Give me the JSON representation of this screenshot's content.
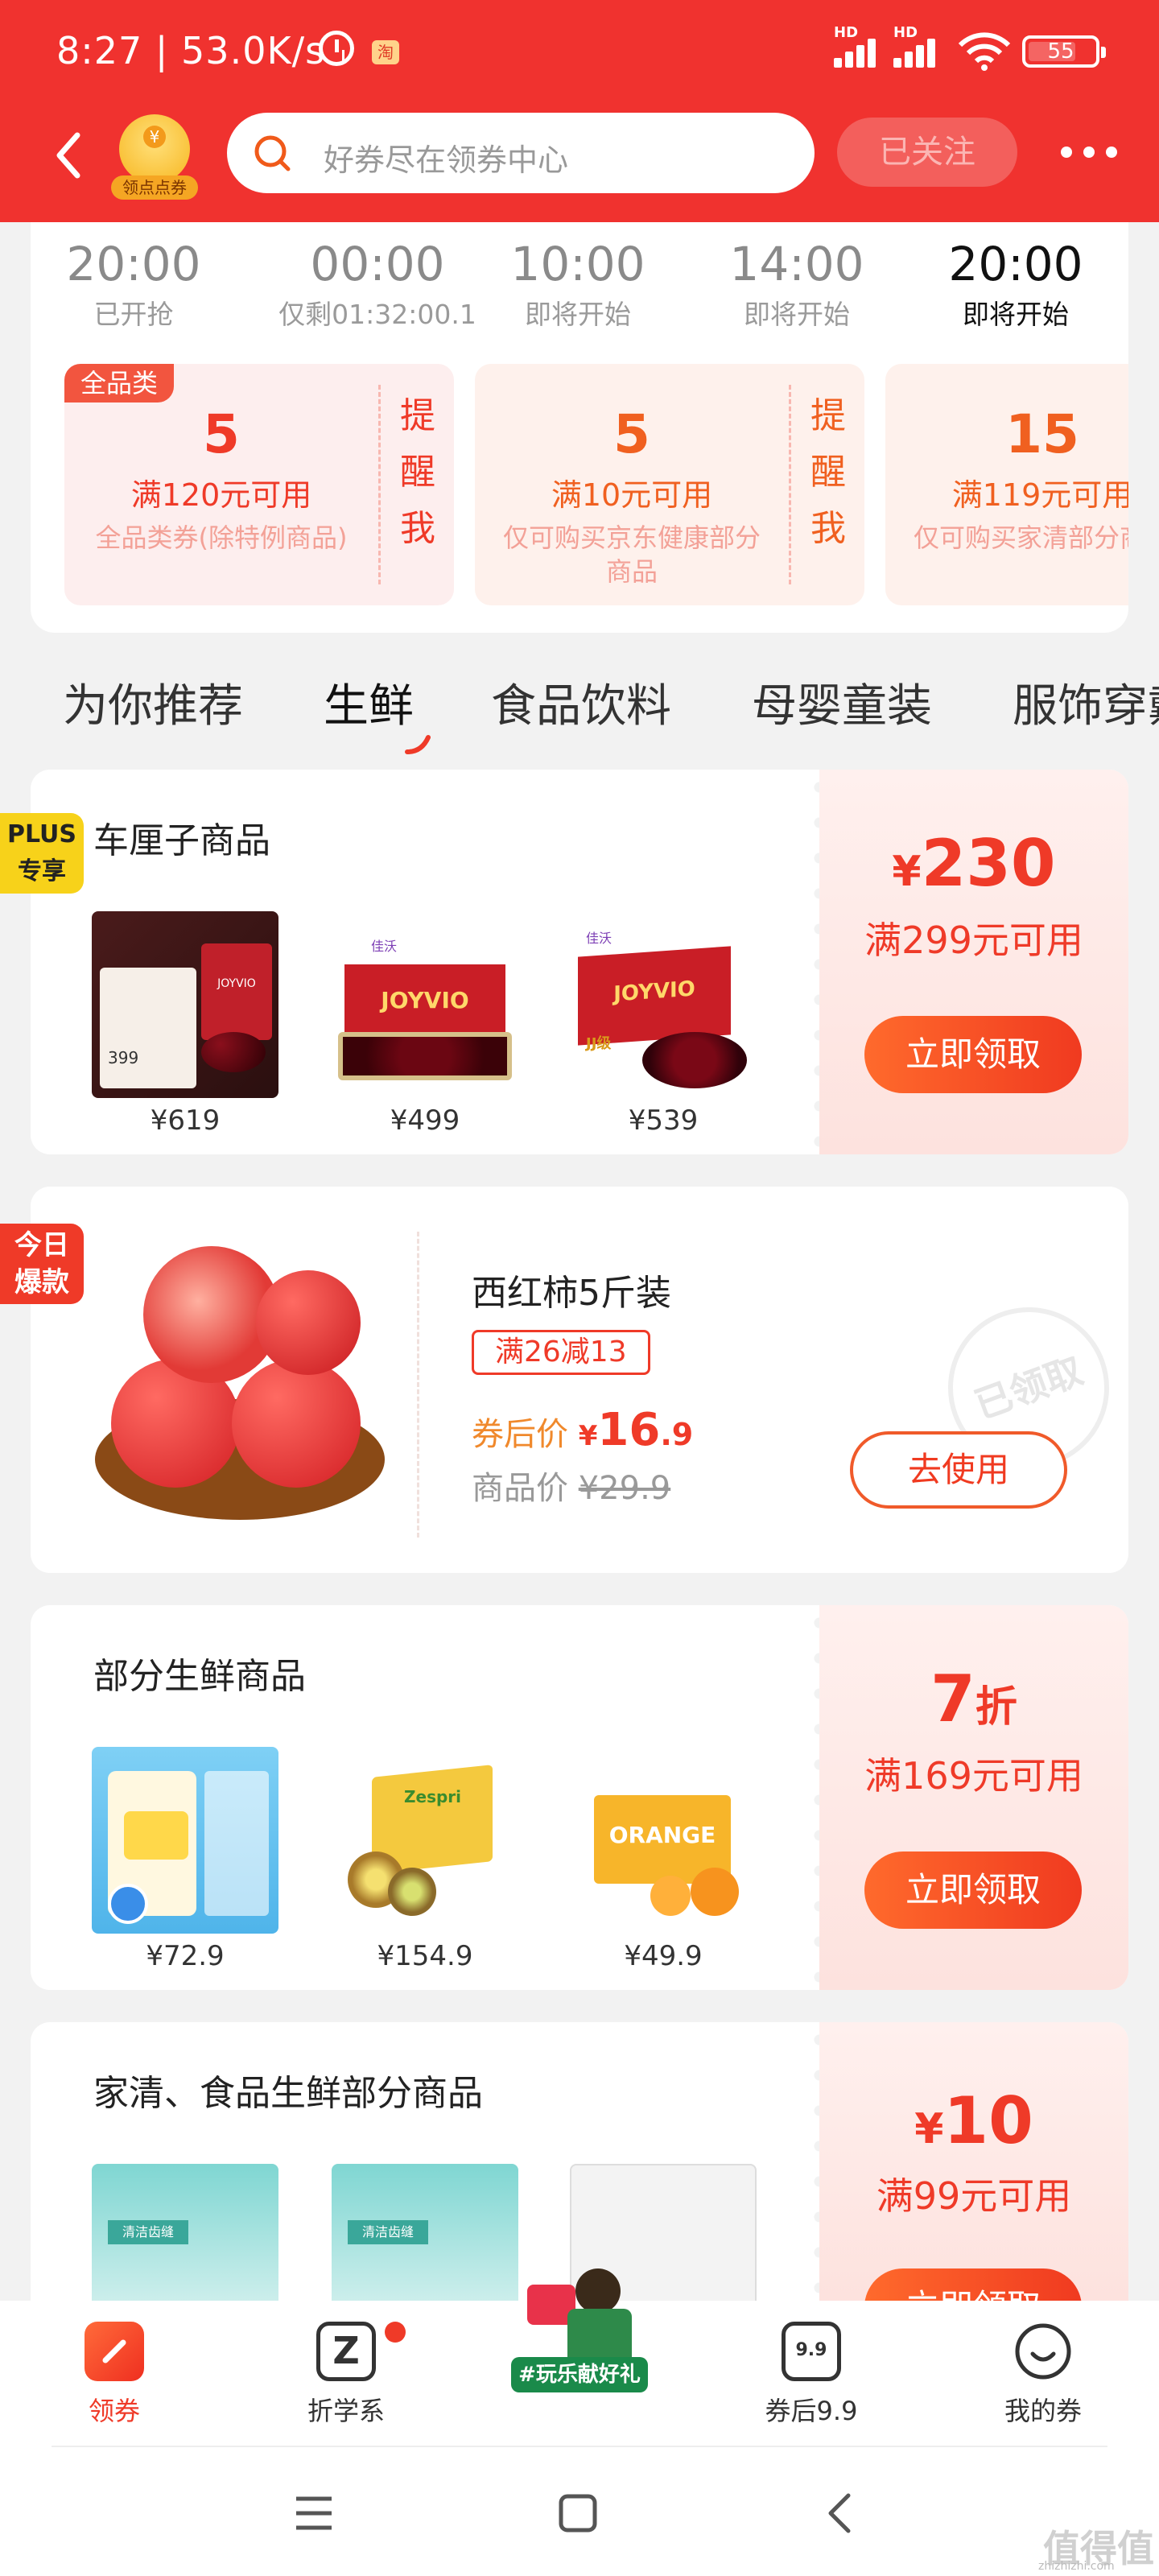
{
  "status_bar": {
    "time": "8:27 | 53.0K/s",
    "battery": "55",
    "hd1": "HD",
    "hd2": "HD",
    "wifi_num": "6"
  },
  "header": {
    "logo_label": "领点点券",
    "search_placeholder": "好券尽在领券中心",
    "follow_label": "已关注"
  },
  "timeslots": [
    {
      "time": "20:00",
      "status": "已开抢"
    },
    {
      "time": "00:00",
      "status": "仅剩01:32:00.1"
    },
    {
      "time": "10:00",
      "status": "即将开始"
    },
    {
      "time": "14:00",
      "status": "即将开始"
    },
    {
      "time": "20:00",
      "status": "即将开始"
    }
  ],
  "flash_coupons": [
    {
      "badge": "全品类",
      "amount": "5",
      "condition": "满120元可用",
      "desc": "全品类券(除特例商品)",
      "remind": "提醒我"
    },
    {
      "badge": "",
      "amount": "5",
      "condition": "满10元可用",
      "desc": "仅可购买京东健康部分商品",
      "remind": "提醒我"
    },
    {
      "badge": "",
      "amount": "15",
      "condition": "满119元可用",
      "desc": "仅可购买家清部分商品",
      "remind": ""
    }
  ],
  "categories": [
    "为你推荐",
    "生鲜",
    "食品饮料",
    "母婴童装",
    "服饰穿戴"
  ],
  "card1": {
    "ribbon": "PLUS专享",
    "ribbon_l1": "PLUS",
    "ribbon_l2": "专享",
    "title": "车厘子商品",
    "currency": "¥",
    "amount": "230",
    "condition": "满299元可用",
    "button": "立即领取",
    "products": [
      {
        "price": "¥619",
        "mini_price": "399",
        "brand": "JOYVIO"
      },
      {
        "price": "¥499",
        "brand": "JOYVIO"
      },
      {
        "price": "¥539",
        "brand": "JOYVIO",
        "grade": "JJ级"
      }
    ]
  },
  "card2": {
    "ribbon_l1": "今日",
    "ribbon_l2": "爆款",
    "title": "西红柿5斤装",
    "tag": "满26减13",
    "after_label": "券后价",
    "currency": "¥",
    "after_price": "16",
    "after_decimal": ".9",
    "orig_label": "商品价",
    "orig_price": "¥29.9",
    "button": "去使用",
    "stamp": "已领取"
  },
  "card3": {
    "title": "部分生鲜商品",
    "amount": "7",
    "unit": "折",
    "condition": "满169元可用",
    "button": "立即领取",
    "products": [
      {
        "price": "¥72.9"
      },
      {
        "price": "¥154.9",
        "brand": "Zespri"
      },
      {
        "price": "¥49.9",
        "brand": "ORANGE"
      }
    ]
  },
  "card4": {
    "title": "家清、食品生鲜部分商品",
    "currency": "¥",
    "amount": "10",
    "condition": "满99元可用",
    "button": "立即领取",
    "products": [
      {
        "label": "清洁齿缝"
      },
      {
        "label": "清洁齿缝"
      },
      {
        "label": ""
      }
    ]
  },
  "bottom_nav": [
    {
      "label": "领券",
      "icon": "coupon-icon",
      "active": true
    },
    {
      "label": "折学系",
      "icon": "z-icon",
      "dot": true
    },
    {
      "label": "#玩乐献好礼",
      "icon": "gift-banner"
    },
    {
      "label": "券后9.9",
      "icon": "nine-icon",
      "icon_text": "9.9"
    },
    {
      "label": "我的券",
      "icon": "smile-icon"
    }
  ],
  "watermark": "值得值",
  "watermark_url": "zhizhizhi.com",
  "colors": {
    "brand": "#f0322f",
    "accent": "#ef3a28",
    "bg": "#f2f2f2"
  }
}
